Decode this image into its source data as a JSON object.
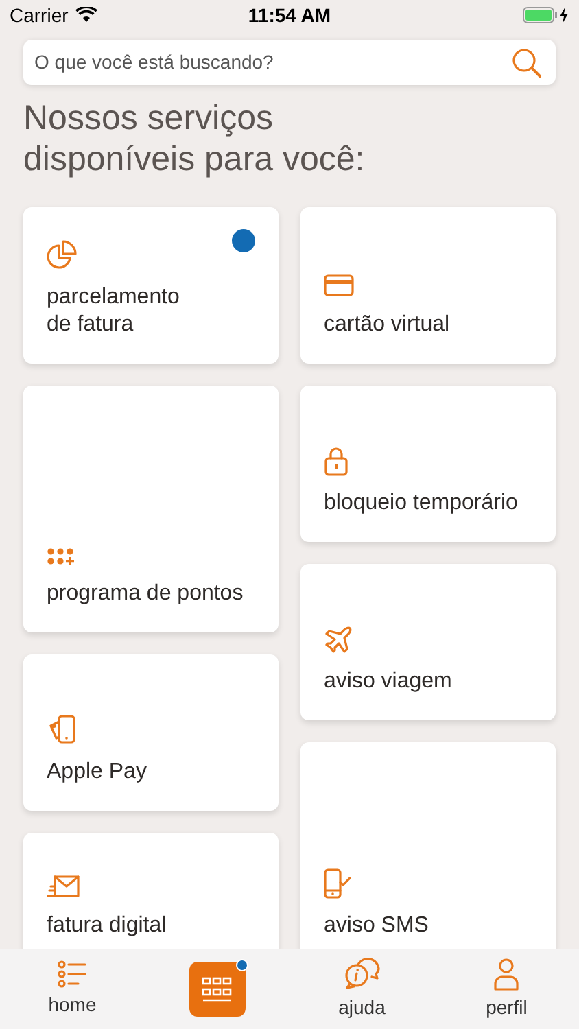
{
  "status_bar": {
    "carrier": "Carrier",
    "time": "11:54 AM"
  },
  "search": {
    "placeholder": "O que você está buscando?"
  },
  "heading": "Nossos serviços disponíveis para você:",
  "columns": [
    [
      {
        "label": "parcelamento\nde fatura",
        "badge": true
      },
      {
        "label": "programa de pontos"
      },
      {
        "label": "Apple Pay"
      },
      {
        "label": "fatura digital"
      }
    ],
    [
      {
        "label": "cartão virtual"
      },
      {
        "label": "bloqueio temporário"
      },
      {
        "label": "aviso viagem"
      },
      {
        "label": "aviso SMS"
      }
    ]
  ],
  "tabs": [
    {
      "label": "home",
      "selected": false
    },
    {
      "selected": true,
      "badge": true
    },
    {
      "label": "ajuda",
      "selected": false
    },
    {
      "label": "perfil",
      "selected": false
    }
  ]
}
